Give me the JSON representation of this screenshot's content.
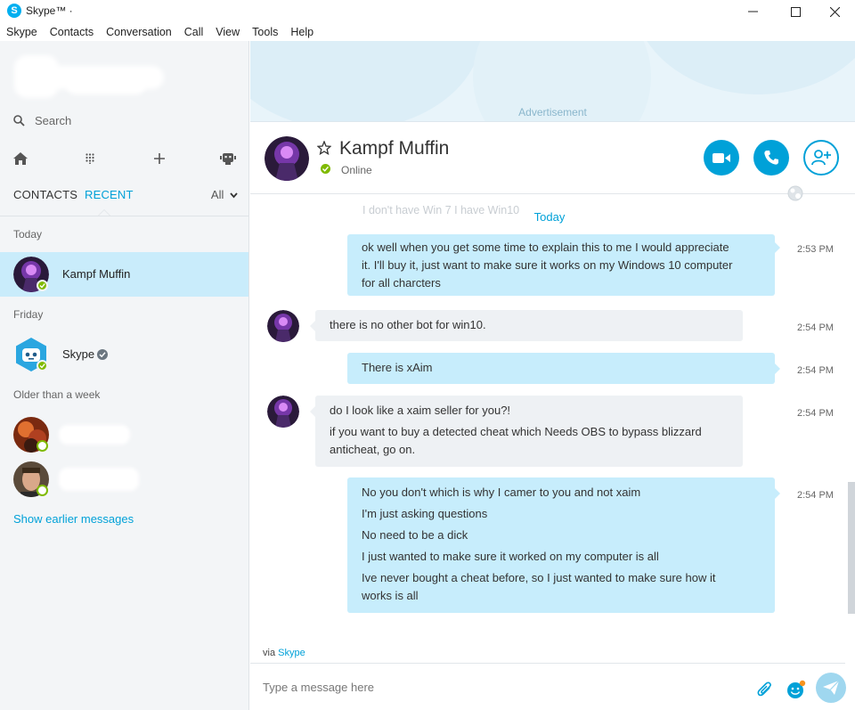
{
  "window": {
    "title": "Skype™ ·",
    "logo_letter": "S"
  },
  "menu": [
    "Skype",
    "Contacts",
    "Conversation",
    "Call",
    "View",
    "Tools",
    "Help"
  ],
  "sidebar": {
    "search_placeholder": "Search",
    "tabs": {
      "contacts": "CONTACTS",
      "recent": "RECENT",
      "filter": "All"
    },
    "sections": {
      "today": "Today",
      "friday": "Friday",
      "older": "Older than a week"
    },
    "recent": [
      {
        "name": "Kampf Muffin",
        "status": "online"
      },
      {
        "name": "Skype",
        "status": "online"
      }
    ],
    "show_earlier": "Show earlier messages"
  },
  "ad_label": "Advertisement",
  "conversation": {
    "name": "Kampf Muffin",
    "status": "Online",
    "faded_line": "I don't have Win 7 I have Win10",
    "date_divider": "Today",
    "messages": [
      {
        "dir": "out",
        "time": "2:53 PM",
        "lines": [
          "ok well when you get some time to explain this to me I would appreciate",
          "it.  I'll buy it, just want to make sure it works on my Windows 10 computer",
          "for all charcters"
        ]
      },
      {
        "dir": "in",
        "time": "2:54 PM",
        "lines": [
          "there is no other bot for win10."
        ]
      },
      {
        "dir": "out",
        "time": "2:54 PM",
        "lines": [
          "There is xAim"
        ]
      },
      {
        "dir": "in",
        "time": "2:54 PM",
        "lines": [
          "do I look like a xaim seller for you?!",
          "if you want to buy a detected cheat which Needs OBS to bypass blizzard",
          "anticheat, go on."
        ]
      },
      {
        "dir": "out",
        "time": "2:54 PM",
        "lines": [
          "No you don't which is why I camer to you and not xaim",
          "I'm just asking questions",
          "No need to be a dick",
          "I just wanted to make sure it worked on my computer is all",
          "Ive never bought a cheat before, so I just wanted to make sure how it",
          "works is all"
        ]
      }
    ],
    "via_prefix": "via",
    "via_app": "Skype",
    "compose_placeholder": "Type a message here"
  },
  "colors": {
    "accent": "#00a1d8",
    "online": "#7fba00",
    "out_bubble": "#c7edfc",
    "in_bubble": "#eef1f4"
  }
}
